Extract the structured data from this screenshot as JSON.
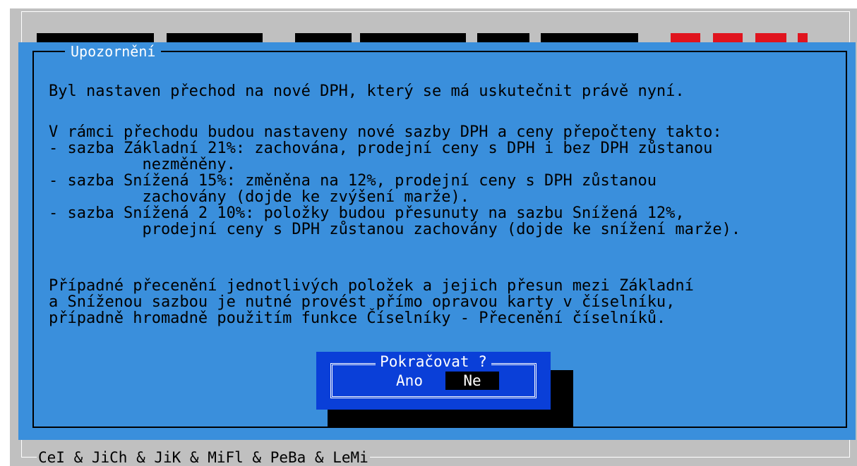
{
  "colors": {
    "screen_background": "#c0c0c0",
    "dialog_background": "#3a8fdc",
    "confirm_background": "#0a3fd8",
    "selected_option_background": "#000000",
    "accent_red": "#e0141e"
  },
  "warning_dialog": {
    "title": "Upozornění",
    "paragraph1": "Byl nastaven přechod na nové DPH, který se má uskutečnit právě nyní.",
    "paragraph2": "V rámci přechodu budou nastaveny nové sazby DPH a ceny přepočteny takto:\n- sazba Základní 21%: zachována, prodejní ceny s DPH i bez DPH zůstanou\n          nezměněny.\n- sazba Snížená 15%: změněna na 12%, prodejní ceny s DPH zůstanou\n          zachovány (dojde ke zvýšení marže).\n- sazba Snížená 2 10%: položky budou přesunuty na sazbu Snížená 12%,\n          prodejní ceny s DPH zůstanou zachovány (dojde ke snížení marže).",
    "paragraph3": "Případné přecenění jednotlivých položek a jejich přesun mezi Základní\na Sníženou sazbou je nutné provést přímo opravou karty v číselníku,\npřípadně hromadně použitím funkce Číselníky - Přecenění číselníků."
  },
  "confirm_dialog": {
    "title": "Pokračovat ?",
    "yes_label": "Ano",
    "no_label": "Ne",
    "selected": "Ne"
  },
  "footer": {
    "credits": "CeI & JiCh & JiK & MiFl & PeBa & LeMi"
  }
}
